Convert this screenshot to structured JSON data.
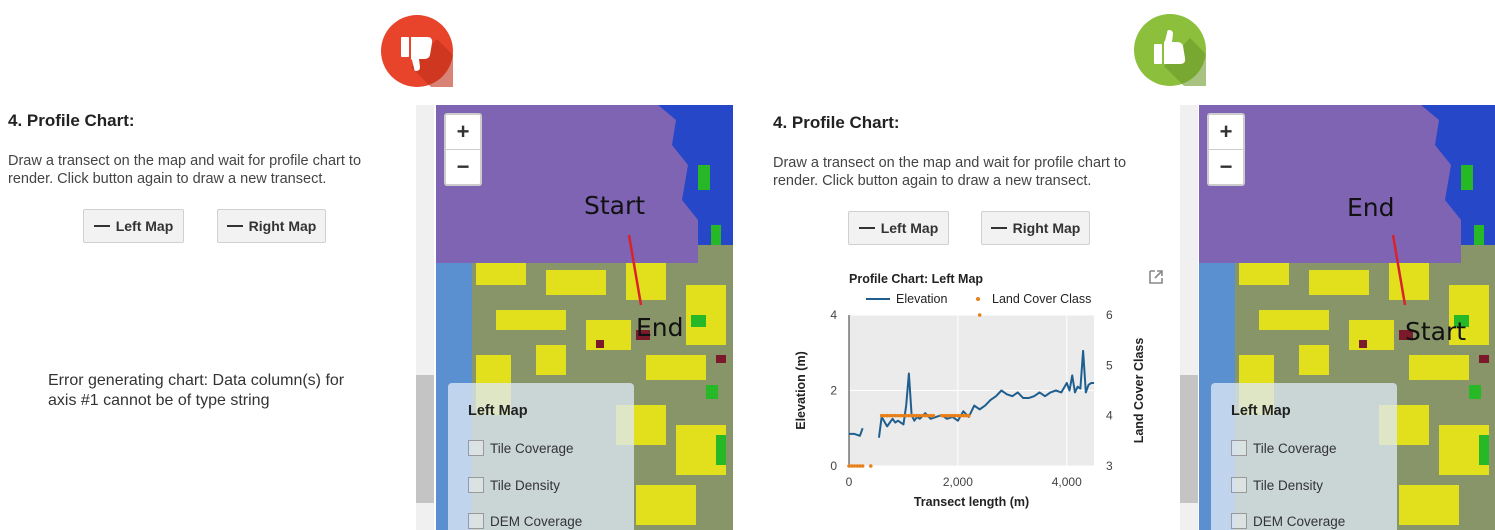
{
  "badges": {
    "bad": "thumbs-down",
    "good": "thumbs-up",
    "bad_color": "#e8432b",
    "good_color": "#8bbf3c"
  },
  "left_panel": {
    "title": "4. Profile Chart:",
    "description": "Draw a transect on the map and wait for profile chart to render. Click button again to draw a new transect.",
    "left_button": "Left Map",
    "right_button": "Right Map",
    "error": "Error generating chart: Data column(s) for axis #1 cannot be of type string"
  },
  "right_panel": {
    "title": "4. Profile Chart:",
    "description": "Draw a transect on the map and wait for profile chart to render. Click button again to draw a new transect.",
    "left_button": "Left Map",
    "right_button": "Right Map"
  },
  "map_left": {
    "zoom_in": "+",
    "zoom_out": "−",
    "label_start": "Start",
    "label_end": "End",
    "legend_title": "Left Map",
    "legend_items": [
      "Tile Coverage",
      "Tile Density",
      "DEM Coverage"
    ]
  },
  "map_right": {
    "zoom_in": "+",
    "zoom_out": "−",
    "label_start": "Start",
    "label_end": "End",
    "legend_title": "Left Map",
    "legend_items": [
      "Tile Coverage",
      "Tile Density",
      "DEM Coverage"
    ]
  },
  "chart_data": {
    "type": "line",
    "title": "Profile Chart: Left Map",
    "xlabel": "Transect length (m)",
    "ylabel": "Elevation (m)",
    "y2label": "Land Cover Class",
    "xlim": [
      0,
      4500
    ],
    "ylim": [
      0,
      4
    ],
    "y2lim": [
      3,
      6
    ],
    "x_ticks": [
      "0",
      "2,000",
      "4,000"
    ],
    "y_ticks": [
      "0",
      "2",
      "4"
    ],
    "y2_ticks": [
      "3",
      "4",
      "5",
      "6"
    ],
    "series": [
      {
        "name": "Elevation",
        "color": "#1f5f8f",
        "axis": "left",
        "x": [
          0,
          100,
          200,
          250,
          550,
          600,
          700,
          800,
          850,
          900,
          1000,
          1050,
          1100,
          1150,
          1200,
          1250,
          1300,
          1400,
          1500,
          1600,
          1700,
          1800,
          1900,
          2000,
          2100,
          2200,
          2300,
          2400,
          2500,
          2600,
          2700,
          2800,
          2900,
          3000,
          3100,
          3200,
          3300,
          3400,
          3500,
          3600,
          3700,
          3800,
          3900,
          4000,
          4050,
          4100,
          4150,
          4200,
          4250,
          4300,
          4350,
          4400,
          4450,
          4500
        ],
        "y": [
          0.85,
          0.85,
          0.8,
          1.0,
          0.75,
          1.3,
          1.05,
          1.25,
          1.15,
          1.2,
          1.1,
          1.6,
          2.45,
          1.35,
          1.2,
          1.3,
          1.25,
          1.4,
          1.25,
          1.3,
          1.35,
          1.25,
          1.3,
          1.2,
          1.45,
          1.3,
          1.6,
          1.5,
          1.6,
          1.75,
          1.85,
          2.0,
          1.9,
          1.85,
          1.95,
          1.8,
          1.8,
          1.85,
          1.95,
          1.85,
          1.95,
          2.0,
          1.95,
          2.2,
          2.0,
          2.4,
          1.95,
          2.1,
          2.05,
          3.05,
          1.95,
          2.15,
          2.2,
          2.2
        ]
      },
      {
        "name": "Land Cover Class",
        "color": "#e8801a",
        "axis": "right",
        "x": [
          0,
          50,
          100,
          150,
          200,
          250,
          400,
          600,
          650,
          700,
          750,
          800,
          850,
          900,
          950,
          1000,
          1050,
          1100,
          1150,
          1200,
          1250,
          1300,
          1350,
          1400,
          1450,
          1500,
          1550,
          1700,
          1750,
          1800,
          1850,
          1900,
          1950,
          2000,
          2050,
          2100,
          2150,
          2200,
          2400
        ],
        "y": [
          3,
          3,
          3,
          3,
          3,
          3,
          3,
          4,
          4,
          4,
          4,
          4,
          4,
          4,
          4,
          4,
          4,
          4,
          4,
          4,
          4,
          4,
          4,
          4,
          4,
          4,
          4,
          4,
          4,
          4,
          4,
          4,
          4,
          4,
          4,
          4,
          4,
          4,
          6
        ]
      }
    ]
  },
  "popout_icon": "open-in-new-icon"
}
